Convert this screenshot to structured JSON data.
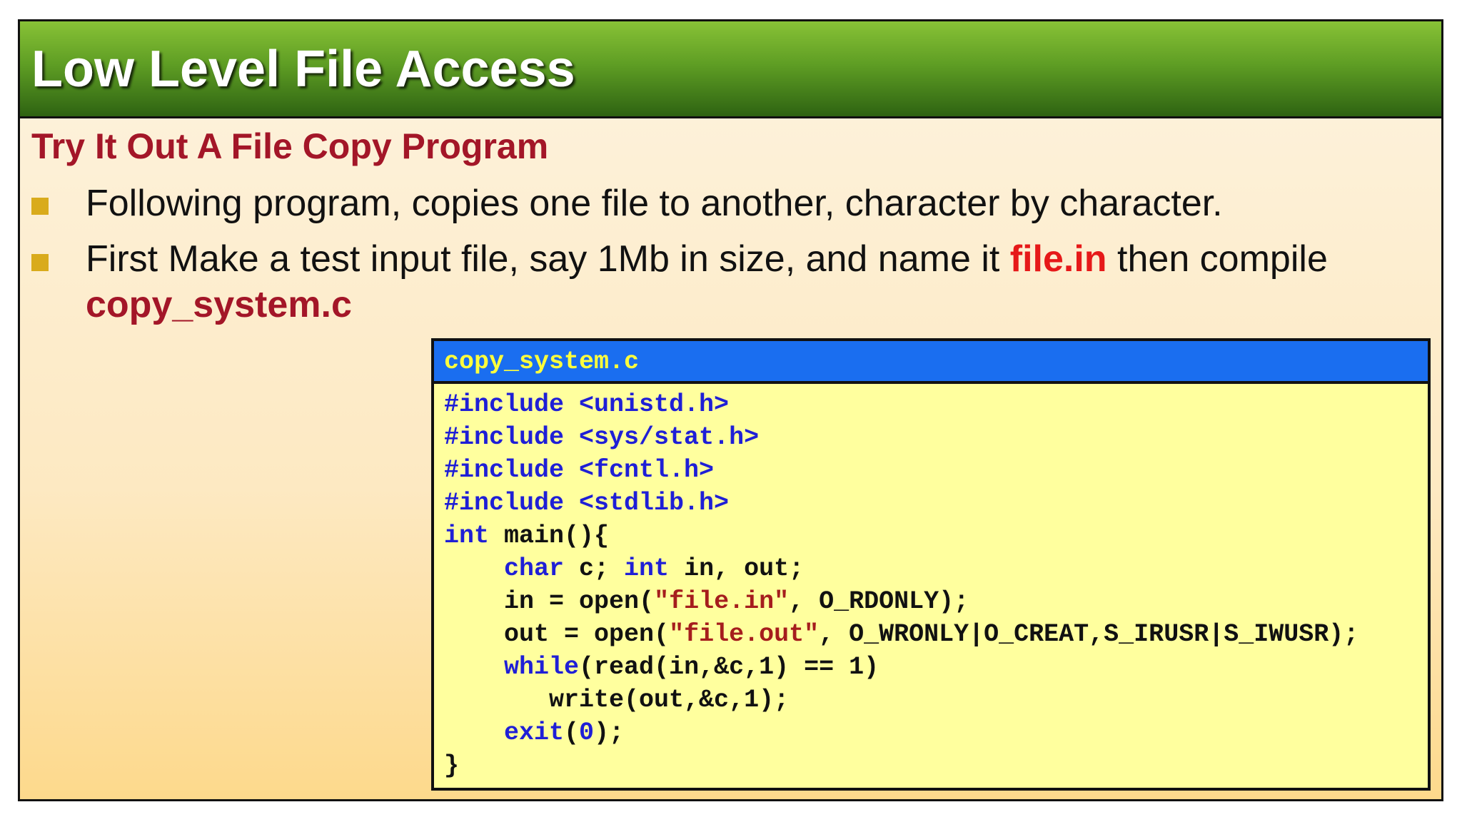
{
  "slide": {
    "title": "Low Level File Access",
    "subtitle": "Try It Out A File Copy Program",
    "bullets": [
      {
        "text": "Following program, copies one file to another, character by character."
      },
      {
        "text_before": "First Make a test input file, say 1Mb in size, and name it ",
        "highlight": "file.in",
        "text_after": " then compile",
        "emphasis": "copy_system.c"
      }
    ]
  },
  "code_box": {
    "filename": "copy_system.c",
    "lines": [
      "#include <unistd.h>",
      "#include <sys/stat.h>",
      "#include <fcntl.h>",
      "#include <stdlib.h>",
      "int main(){",
      "    char c; int in, out;",
      "    in = open(\"file.in\", O_RDONLY);",
      "    out = open(\"file.out\", O_WRONLY|O_CREAT,S_IRUSR|S_IWUSR);",
      "    while(read(in,&c,1) == 1)",
      "       write(out,&c,1);",
      "    exit(0);",
      "}"
    ]
  },
  "colors": {
    "title_bar_green": "#5f9e24",
    "subtitle_red": "#a31628",
    "highlight_red": "#e61919",
    "bullet_gold": "#d9ab1c",
    "code_header_blue": "#1a6ef0",
    "code_filename_yellow": "#ffff3c",
    "code_background": "#ffff9e",
    "code_keyword_blue": "#1f1fd6",
    "code_string_red": "#a51d1d"
  }
}
